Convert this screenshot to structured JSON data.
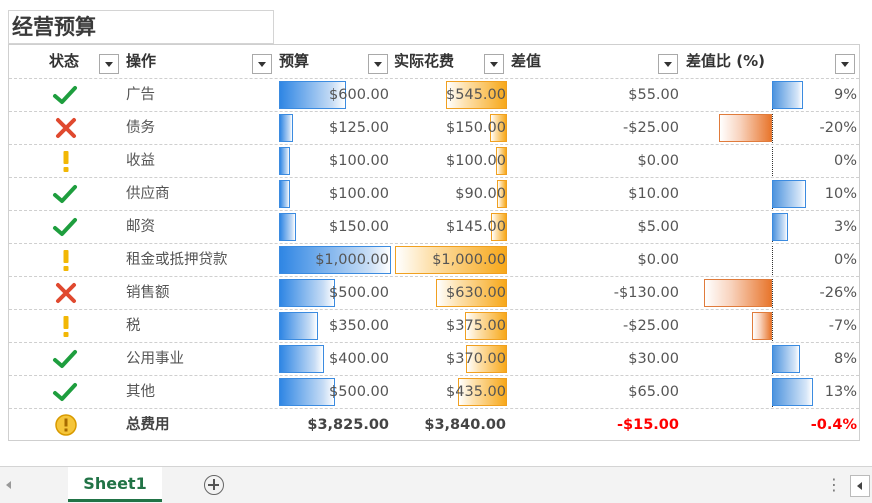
{
  "title": "经营预算",
  "headers": [
    "状态",
    "操作",
    "预算",
    "实际花费",
    "差值",
    "差值比 (%)"
  ],
  "rows": [
    {
      "status": "ok",
      "category": "广告",
      "budget": "$600.00",
      "budget_value": 600,
      "actual": "$545.00",
      "actual_value": 545,
      "diff": "$55.00",
      "ratio": "9%",
      "ratio_value": 9
    },
    {
      "status": "bad",
      "category": "债务",
      "budget": "$125.00",
      "budget_value": 125,
      "actual": "$150.00",
      "actual_value": 150,
      "diff": "-$25.00",
      "ratio": "-20%",
      "ratio_value": -20
    },
    {
      "status": "warn",
      "category": "收益",
      "budget": "$100.00",
      "budget_value": 100,
      "actual": "$100.00",
      "actual_value": 100,
      "diff": "$0.00",
      "ratio": "0%",
      "ratio_value": 0
    },
    {
      "status": "ok",
      "category": "供应商",
      "budget": "$100.00",
      "budget_value": 100,
      "actual": "$90.00",
      "actual_value": 90,
      "diff": "$10.00",
      "ratio": "10%",
      "ratio_value": 10
    },
    {
      "status": "ok",
      "category": "邮资",
      "budget": "$150.00",
      "budget_value": 150,
      "actual": "$145.00",
      "actual_value": 145,
      "diff": "$5.00",
      "ratio": "3%",
      "ratio_value": 3
    },
    {
      "status": "warn",
      "category": "租金或抵押贷款",
      "budget": "$1,000.00",
      "budget_value": 1000,
      "actual": "$1,000.00",
      "actual_value": 1000,
      "diff": "$0.00",
      "ratio": "0%",
      "ratio_value": 0
    },
    {
      "status": "bad",
      "category": "销售额",
      "budget": "$500.00",
      "budget_value": 500,
      "actual": "$630.00",
      "actual_value": 630,
      "diff": "-$130.00",
      "ratio": "-26%",
      "ratio_value": -26
    },
    {
      "status": "warn",
      "category": "税",
      "budget": "$350.00",
      "budget_value": 350,
      "actual": "$375.00",
      "actual_value": 375,
      "diff": "-$25.00",
      "ratio": "-7%",
      "ratio_value": -7
    },
    {
      "status": "ok",
      "category": "公用事业",
      "budget": "$400.00",
      "budget_value": 400,
      "actual": "$370.00",
      "actual_value": 370,
      "diff": "$30.00",
      "ratio": "8%",
      "ratio_value": 8
    },
    {
      "status": "ok",
      "category": "其他",
      "budget": "$500.00",
      "budget_value": 500,
      "actual": "$435.00",
      "actual_value": 435,
      "diff": "$65.00",
      "ratio": "13%",
      "ratio_value": 13
    }
  ],
  "total": {
    "label": "总费用",
    "budget": "$3,825.00",
    "actual": "$3,840.00",
    "diff": "-$15.00",
    "ratio": "-0.4%"
  },
  "sheet_tab": "Sheet1",
  "colors": {
    "ok": "#1e9e3e",
    "bad": "#e0492f",
    "warn": "#f2b705",
    "accent": "#217346",
    "negative_total": "#ff0000"
  },
  "icons": {
    "ok": "check-icon",
    "bad": "cross-icon",
    "warn": "exclamation-icon",
    "total": "warning-circle-icon",
    "filter": "dropdown-arrow-icon",
    "add": "add-sheet-icon"
  }
}
